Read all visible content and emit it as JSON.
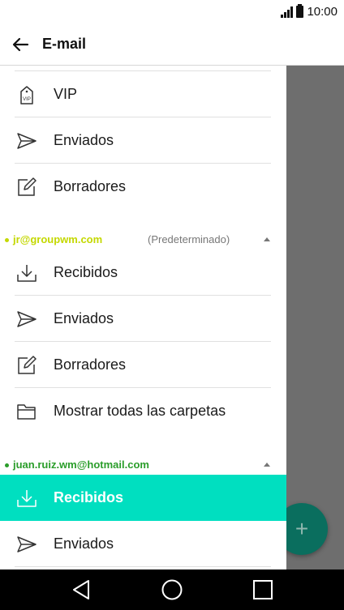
{
  "status_bar": {
    "time": "10:00"
  },
  "header": {
    "title": "E-mail"
  },
  "drawer": {
    "top_items": [
      {
        "label": "VIP",
        "icon": "vip-tag-icon"
      },
      {
        "label": "Enviados",
        "icon": "send-icon"
      },
      {
        "label": "Borradores",
        "icon": "draft-icon"
      }
    ],
    "account1": {
      "email": "jr@groupwm.com",
      "default_label": "(Predeterminado)",
      "color": "#c4d800",
      "items": [
        {
          "label": "Recibidos",
          "icon": "inbox-icon"
        },
        {
          "label": "Enviados",
          "icon": "send-icon"
        },
        {
          "label": "Borradores",
          "icon": "draft-icon"
        },
        {
          "label": "Mostrar todas las carpetas",
          "icon": "folder-icon"
        }
      ]
    },
    "account2": {
      "email": "juan.ruiz.wm@hotmail.com",
      "color": "#2a9d2a",
      "items": [
        {
          "label": "Recibidos",
          "icon": "inbox-icon",
          "active": true
        },
        {
          "label": "Enviados",
          "icon": "send-icon"
        }
      ]
    }
  },
  "fab": {
    "label": "+"
  },
  "colors": {
    "active": "#00dfc0",
    "fab": "#0a6e5e",
    "scrim": "#6e6e6e"
  }
}
